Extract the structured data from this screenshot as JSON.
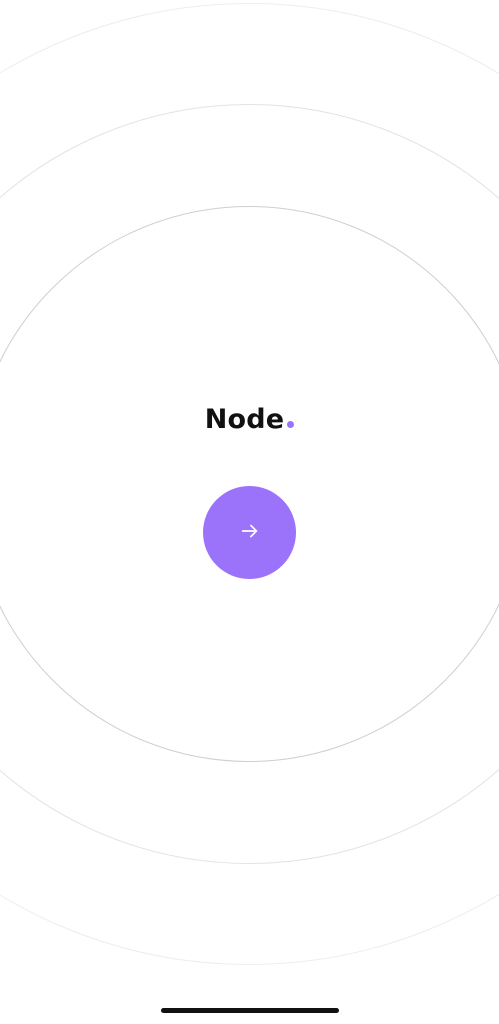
{
  "app": {
    "logo_text": "Node",
    "accent_color": "#9b72fa"
  },
  "next_button": {
    "icon": "arrow-right-icon"
  },
  "system": {
    "home_indicator": "home-indicator"
  }
}
